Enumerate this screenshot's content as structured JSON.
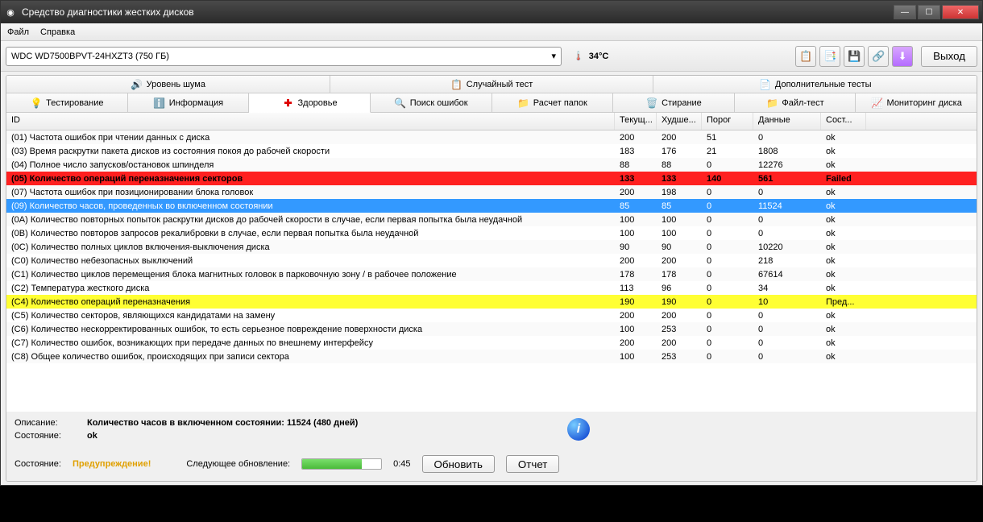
{
  "window": {
    "title": "Средство диагностики жестких дисков"
  },
  "menu": {
    "file": "Файл",
    "help": "Справка"
  },
  "toolbar": {
    "disk": "WDC WD7500BPVT-24HXZT3 (750 ГБ)",
    "temp": "34°C",
    "exit": "Выход"
  },
  "tabs_top": [
    {
      "icon": "🔊",
      "label": "Уровень шума"
    },
    {
      "icon": "📋",
      "label": "Случайный тест"
    },
    {
      "icon": "📄",
      "label": "Дополнительные тесты"
    }
  ],
  "tabs_bottom": [
    {
      "icon": "💡",
      "label": "Тестирование"
    },
    {
      "icon": "ℹ️",
      "label": "Информация"
    },
    {
      "icon": "✚",
      "label": "Здоровье",
      "active": true
    },
    {
      "icon": "🔍",
      "label": "Поиск ошибок"
    },
    {
      "icon": "📁",
      "label": "Расчет папок"
    },
    {
      "icon": "🗑️",
      "label": "Стирание"
    },
    {
      "icon": "📁",
      "label": "Файл-тест"
    },
    {
      "icon": "📈",
      "label": "Мониторинг диска"
    }
  ],
  "headers": [
    "ID",
    "Текущ...",
    "Худше...",
    "Порог",
    "Данные",
    "Сост..."
  ],
  "rows": [
    {
      "id": "(01) Частота ошибок при чтении данных с диска",
      "cur": "200",
      "worst": "200",
      "thr": "51",
      "data": "0",
      "st": "ok"
    },
    {
      "id": "(03) Время раскрутки пакета дисков из состояния покоя до рабочей скорости",
      "cur": "183",
      "worst": "176",
      "thr": "21",
      "data": "1808",
      "st": "ok"
    },
    {
      "id": "(04) Полное число запусков/остановок шпинделя",
      "cur": "88",
      "worst": "88",
      "thr": "0",
      "data": "12276",
      "st": "ok"
    },
    {
      "id": "(05) Количество операций переназначения секторов",
      "cur": "133",
      "worst": "133",
      "thr": "140",
      "data": "561",
      "st": "Failed",
      "cls": "row-failed"
    },
    {
      "id": "(07) Частота ошибок при позиционировании блока головок",
      "cur": "200",
      "worst": "198",
      "thr": "0",
      "data": "0",
      "st": "ok"
    },
    {
      "id": "(09) Количество часов, проведенных во включенном состоянии",
      "cur": "85",
      "worst": "85",
      "thr": "0",
      "data": "11524",
      "st": "ok",
      "cls": "row-selected"
    },
    {
      "id": "(0A) Количество повторных попыток раскрутки дисков до рабочей скорости в случае, если первая попытка была неудачной",
      "cur": "100",
      "worst": "100",
      "thr": "0",
      "data": "0",
      "st": "ok"
    },
    {
      "id": "(0B) Количество повторов запросов рекалибровки в случае, если первая попытка была неудачной",
      "cur": "100",
      "worst": "100",
      "thr": "0",
      "data": "0",
      "st": "ok"
    },
    {
      "id": "(0C) Количество полных циклов включения-выключения диска",
      "cur": "90",
      "worst": "90",
      "thr": "0",
      "data": "10220",
      "st": "ok"
    },
    {
      "id": "(C0) Количество небезопасных выключений",
      "cur": "200",
      "worst": "200",
      "thr": "0",
      "data": "218",
      "st": "ok"
    },
    {
      "id": "(C1) Количество циклов перемещения блока магнитных головок в парковочную зону / в рабочее положение",
      "cur": "178",
      "worst": "178",
      "thr": "0",
      "data": "67614",
      "st": "ok"
    },
    {
      "id": "(C2) Температура жесткого диска",
      "cur": "113",
      "worst": "96",
      "thr": "0",
      "data": "34",
      "st": "ok"
    },
    {
      "id": "(C4) Количество операций переназначения",
      "cur": "190",
      "worst": "190",
      "thr": "0",
      "data": "10",
      "st": "Пред...",
      "cls": "row-warning"
    },
    {
      "id": "(C5) Количество секторов, являющихся кандидатами на замену",
      "cur": "200",
      "worst": "200",
      "thr": "0",
      "data": "0",
      "st": "ok"
    },
    {
      "id": "(C6) Количество нескорректированных ошибок, то есть серьезное повреждение поверхности диска",
      "cur": "100",
      "worst": "253",
      "thr": "0",
      "data": "0",
      "st": "ok"
    },
    {
      "id": "(C7) Количество ошибок, возникающих при передаче данных по внешнему интерфейсу",
      "cur": "200",
      "worst": "200",
      "thr": "0",
      "data": "0",
      "st": "ok"
    },
    {
      "id": "(C8) Общее количество ошибок, происходящих при записи сектора",
      "cur": "100",
      "worst": "253",
      "thr": "0",
      "data": "0",
      "st": "ok"
    }
  ],
  "footer": {
    "desc_label": "Описание:",
    "desc_value": "Количество часов в включенном состоянии: 11524 (480 дней)",
    "state_label": "Состояние:",
    "state_value": "ok",
    "overall_label": "Состояние:",
    "overall_value": "Предупреждение!",
    "next_update_label": "Следующее обновление:",
    "next_update_time": "0:45",
    "refresh": "Обновить",
    "report": "Отчет"
  }
}
